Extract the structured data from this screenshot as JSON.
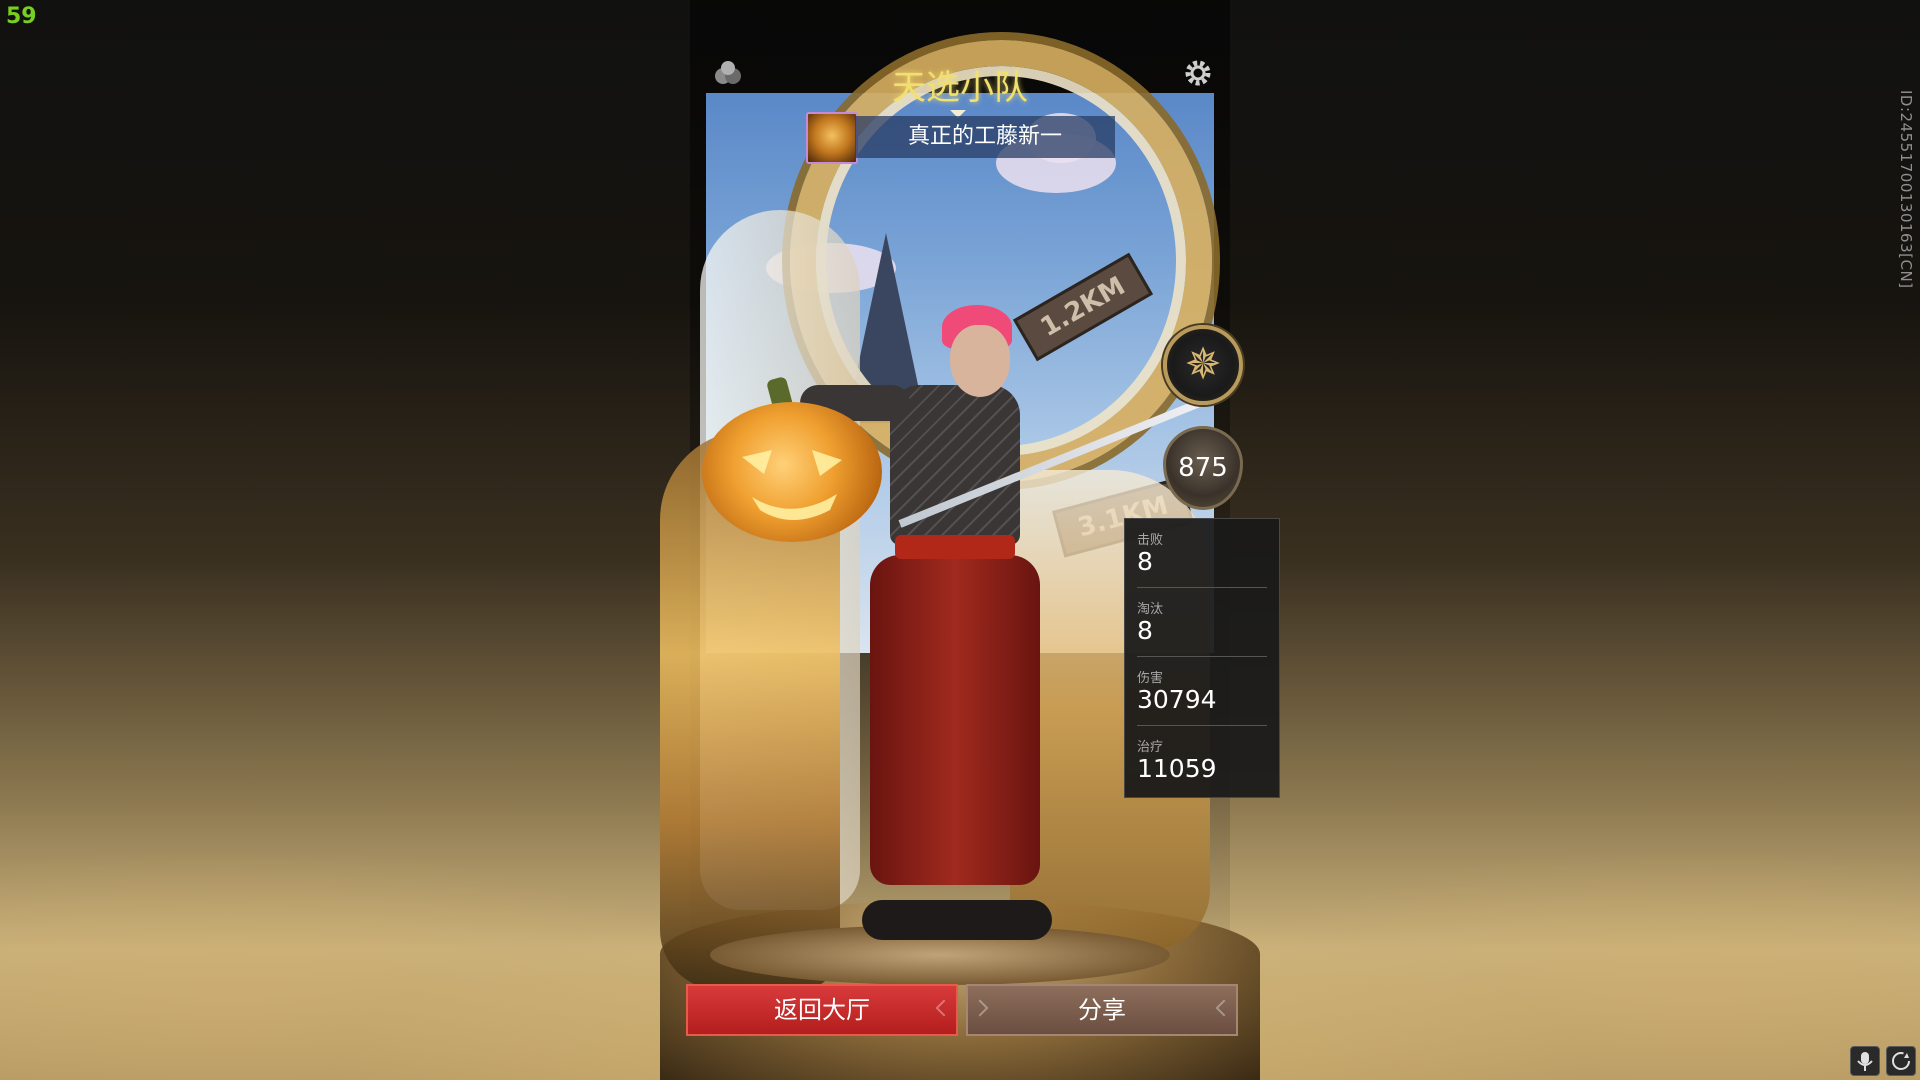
{
  "hud": {
    "fps": "59",
    "player_id": "ID:2455170013016​3[CN]"
  },
  "card": {
    "team_title": "天选小队",
    "player_name": "真正的工藤新一",
    "score": "875"
  },
  "stats": [
    {
      "label": "击败",
      "value": "8"
    },
    {
      "label": "淘汰",
      "value": "8"
    },
    {
      "label": "伤害",
      "value": "30794"
    },
    {
      "label": "治疗",
      "value": "11059"
    }
  ],
  "buttons": {
    "return_label": "返回大厅",
    "share_label": "分享"
  },
  "icons": {
    "top_left": "team-icon",
    "top_right": "settings-gear-icon",
    "rank": "rank-emblem-icon",
    "mic": "microphone-icon",
    "refresh": "refresh-icon"
  },
  "colors": {
    "return_button": "#c42626",
    "share_button": "#7c5c4c",
    "title": "#f0e070",
    "fps": "#77d020"
  }
}
